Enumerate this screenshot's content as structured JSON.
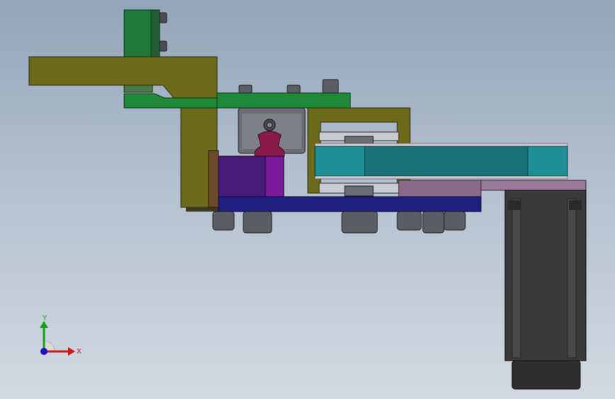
{
  "viewport": {
    "background_top": "#93a5b9",
    "background_bottom": "#d2d9e2"
  },
  "triad": {
    "x_label": "X",
    "y_label": "Y",
    "x_color": "#d01818",
    "y_color": "#18a018",
    "z_color": "#1818c8"
  },
  "parts": {
    "arm_color": "#6e6a1c",
    "plate_color": "#1f7a3a",
    "block_color": "#5a1a8a",
    "rail_color": "#2a2a8a",
    "belt_color": "#1f7f86",
    "mount_color": "#8a6a8a",
    "motor_color": "#3a3a3a",
    "bolt_color": "#5a5e64"
  }
}
